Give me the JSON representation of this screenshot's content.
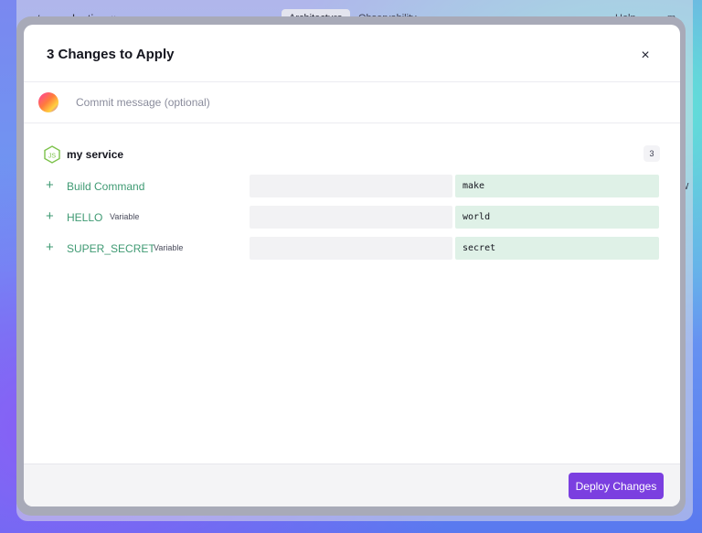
{
  "background_app": {
    "environment": "production",
    "tabs": [
      "Architecture",
      "Observability"
    ],
    "help_label": "Help",
    "more_label": "m",
    "side_partial_left": "s",
    "side_partial_right": "W"
  },
  "modal": {
    "title": "3 Changes to Apply",
    "close_label": "×",
    "commit_placeholder": "Commit message (optional)",
    "service": {
      "name": "my service",
      "change_count": "3",
      "icon": "nodejs-icon"
    },
    "changes": [
      {
        "name": "Build Command",
        "tag": "",
        "old_value": "",
        "new_value": "make"
      },
      {
        "name": "HELLO",
        "tag": "Variable",
        "old_value": "",
        "new_value": "world"
      },
      {
        "name": "SUPER_SECRET",
        "tag": "Variable",
        "old_value": "",
        "new_value": "secret"
      }
    ],
    "deploy_label": "Deploy Changes"
  },
  "colors": {
    "accent": "#7b3fe0",
    "added_text": "#3f9a73",
    "added_bg": "#dff1e7"
  }
}
